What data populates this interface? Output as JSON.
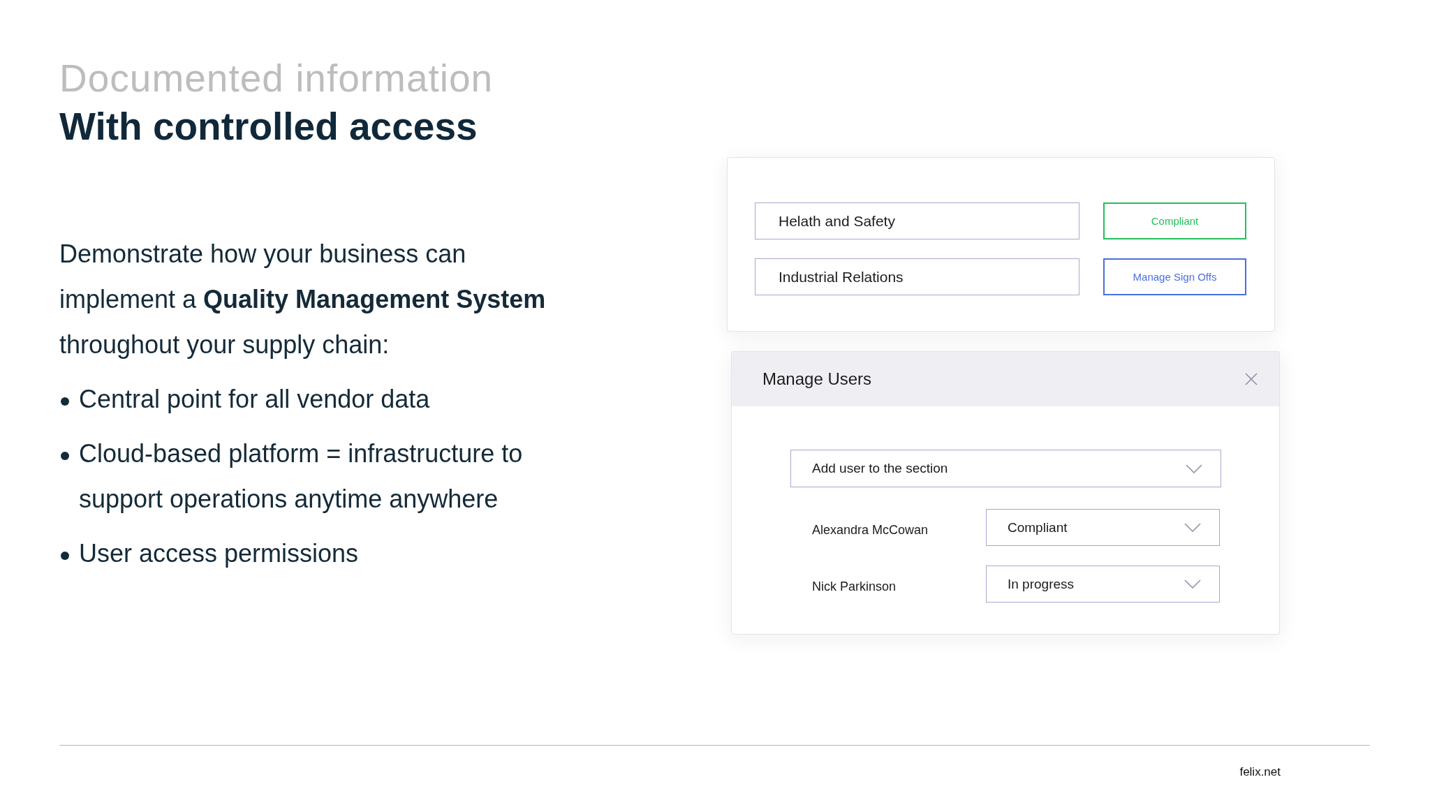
{
  "heading": {
    "subtitle": "Documented information",
    "title": "With controlled access"
  },
  "intro": "Demonstrate how your business can implement a **Quality Management System** throughout your supply chain:",
  "bullets": [
    "Central point for all vendor data",
    "Cloud-based platform = infrastructure to support operations anytime anywhere",
    "User access permissions"
  ],
  "sections_card": {
    "rows": [
      {
        "section": "Helath and Safety",
        "action": {
          "kind": "status",
          "label": "Compliant"
        }
      },
      {
        "section": "Industrial Relations",
        "action": {
          "kind": "button",
          "label": "Manage Sign Offs"
        }
      }
    ]
  },
  "manage_users": {
    "title": "Manage Users",
    "add_user_select": {
      "value": "Add user to the section"
    },
    "users": [
      {
        "name": "Alexandra McCowan",
        "status": "Compliant"
      },
      {
        "name": "Nick Parkinson",
        "status": "In progress"
      }
    ]
  },
  "footer": {
    "site": "felix.net"
  }
}
